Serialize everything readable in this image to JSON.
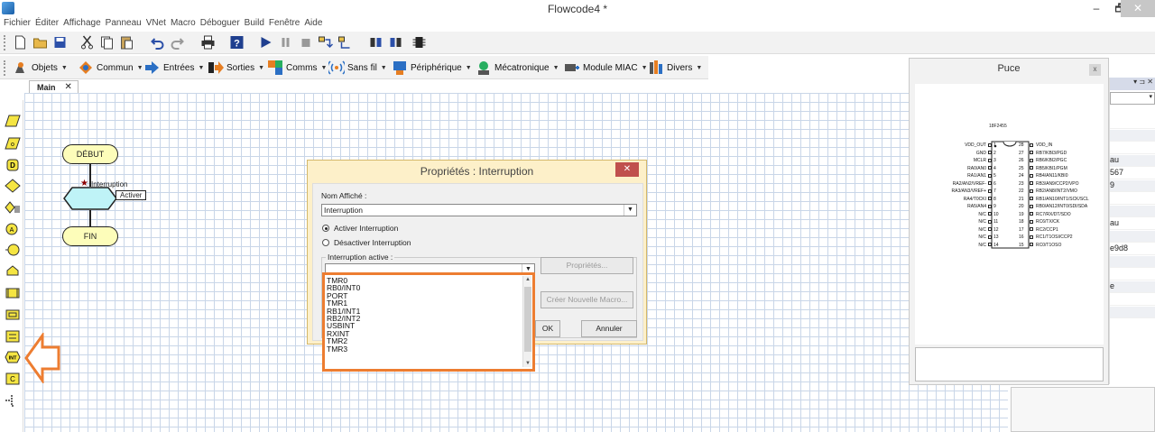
{
  "window": {
    "title": "Flowcode4 *",
    "minimize": "–",
    "maximize": "🗗",
    "close": "✕"
  },
  "menu": [
    "Fichier",
    "Éditer",
    "Affichage",
    "Panneau",
    "VNet",
    "Macro",
    "Déboguer",
    "Build",
    "Fenêtre",
    "Aide"
  ],
  "toolbar_components": [
    {
      "label": "Objets",
      "icon": "objects-icon"
    },
    {
      "label": "Commun",
      "icon": "common-icon"
    },
    {
      "label": "Entrées",
      "icon": "inputs-icon"
    },
    {
      "label": "Sorties",
      "icon": "outputs-icon"
    },
    {
      "label": "Comms",
      "icon": "comms-icon"
    },
    {
      "label": "Sans fil",
      "icon": "wireless-icon"
    },
    {
      "label": "Périphérique",
      "icon": "peripheral-icon"
    },
    {
      "label": "Mécatronique",
      "icon": "mechatronics-icon"
    },
    {
      "label": "Module MIAC",
      "icon": "miac-icon"
    },
    {
      "label": "Divers",
      "icon": "misc-icon"
    }
  ],
  "tabs": {
    "main": "Main",
    "close": "✕"
  },
  "flowchart": {
    "begin": "DÉBUT",
    "end": "FIN",
    "interrupt_label": "Interruption",
    "callout": "Activer",
    "star": "★"
  },
  "dialog": {
    "title": "Propriétés : Interruption",
    "close": "✕",
    "name_label": "Nom Affiché :",
    "name_value": "Interruption",
    "radio_enable": "Activer Interruption",
    "radio_disable": "Désactiver Interruption",
    "active_label": "Interruption active :",
    "props_button": "Propriétés...",
    "new_macro_button": "Créer Nouvelle Macro...",
    "ok_button": "OK",
    "cancel_button": "Annuler",
    "interrupt_options": [
      "TMR0",
      "RB0/INT0",
      "PORT",
      "TMR1",
      "RB1/INT1",
      "RB2/INT2",
      "USBINT",
      "RXINT",
      "TMR2",
      "TMR3"
    ]
  },
  "chip_panel": {
    "title": "Puce",
    "close": "x",
    "chip_name": "18F2455",
    "left_pins": [
      "VDD_OUT",
      "GND",
      "MCLR",
      "RA0/AN0",
      "RA1/AN1",
      "RA2/AN2/VREF-",
      "RA3/AN3/VREF+",
      "RA4/T0CKI",
      "RA5/AN4",
      "N/C",
      "N/C",
      "N/C",
      "N/C",
      "N/C"
    ],
    "right_pins": [
      "VDD_IN",
      "RB7/KBI3/PGD",
      "RB6/KBI2/PGC",
      "RB5/KBI1/PGM",
      "RB4/AN11/KBI0",
      "RB3/AN9/CCP2/VPO",
      "RB2/AN8/INT2/VMO",
      "RB1/AN10/INT1/SCK/SCL",
      "RB0/AN12/INT0/SDI/SDA",
      "RC7/RX/DT/SDO",
      "RC6/TX/CK",
      "RC2/CCP1",
      "RC1/T1OSI/CCP2",
      "RC0/T1OSO"
    ],
    "left_nums": [
      "1",
      "2",
      "3",
      "4",
      "5",
      "6",
      "7",
      "8",
      "9",
      "10",
      "11",
      "12",
      "13",
      "14"
    ],
    "right_nums": [
      "28",
      "27",
      "26",
      "25",
      "24",
      "23",
      "22",
      "21",
      "20",
      "19",
      "18",
      "17",
      "16",
      "15"
    ]
  },
  "right_panel": {
    "header": "▾ ⊐ ✕",
    "rows": [
      "",
      "",
      "",
      "au",
      "567",
      "9",
      "",
      "",
      "au",
      "",
      "e9d8",
      "",
      "",
      "e",
      "",
      ""
    ]
  },
  "colors": {
    "annotation": "#ed7d31",
    "grid": "#c9d6e8",
    "flow_fill": "#fdfdba",
    "decision_fill": "#bff3f7",
    "dialog_frame": "#fdf0c9"
  }
}
